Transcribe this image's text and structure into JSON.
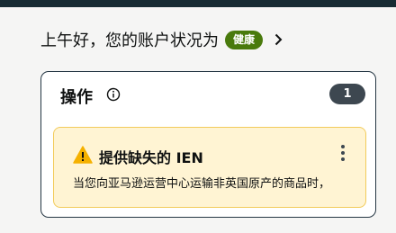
{
  "header": {
    "greeting": "上午好，您的账户状况为",
    "health_badge": "健康",
    "chevron_icon": "chevron-right-icon"
  },
  "actions_card": {
    "title": "操作",
    "info_icon": "info-circle-icon",
    "count": "1",
    "alert": {
      "icon": "warning-triangle-icon",
      "title": "提供缺失的 IEN",
      "body": "当您向亚马逊运营中心运输非英国原产的商品时，",
      "menu_icon": "more-vertical-icon"
    }
  },
  "colors": {
    "top_bar": "#172b33",
    "health_badge": "#497a0c",
    "count_badge": "#3d4750",
    "alert_background": "#fff4d3",
    "alert_border": "#f2cb5a",
    "warning": "#f5b100"
  }
}
